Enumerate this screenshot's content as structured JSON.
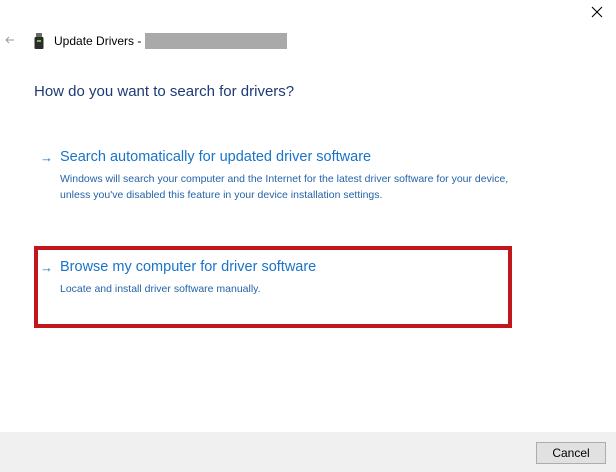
{
  "window": {
    "title": "Update Drivers -",
    "close_icon": "close-icon",
    "back_icon": "back-arrow-icon",
    "device_icon": "usb-device-icon"
  },
  "main": {
    "heading": "How do you want to search for drivers?",
    "options": [
      {
        "arrow": "→",
        "title": "Search automatically for updated driver software",
        "description": "Windows will search your computer and the Internet for the latest driver software for your device, unless you've disabled this feature in your device installation settings."
      },
      {
        "arrow": "→",
        "title": "Browse my computer for driver software",
        "description": "Locate and install driver software manually.",
        "highlighted": true,
        "highlight_color": "#c1161c"
      }
    ]
  },
  "footer": {
    "cancel_label": "Cancel"
  },
  "colors": {
    "heading": "#1e3a76",
    "link": "#1a73c8",
    "footer_bg": "#f0f0f0"
  }
}
